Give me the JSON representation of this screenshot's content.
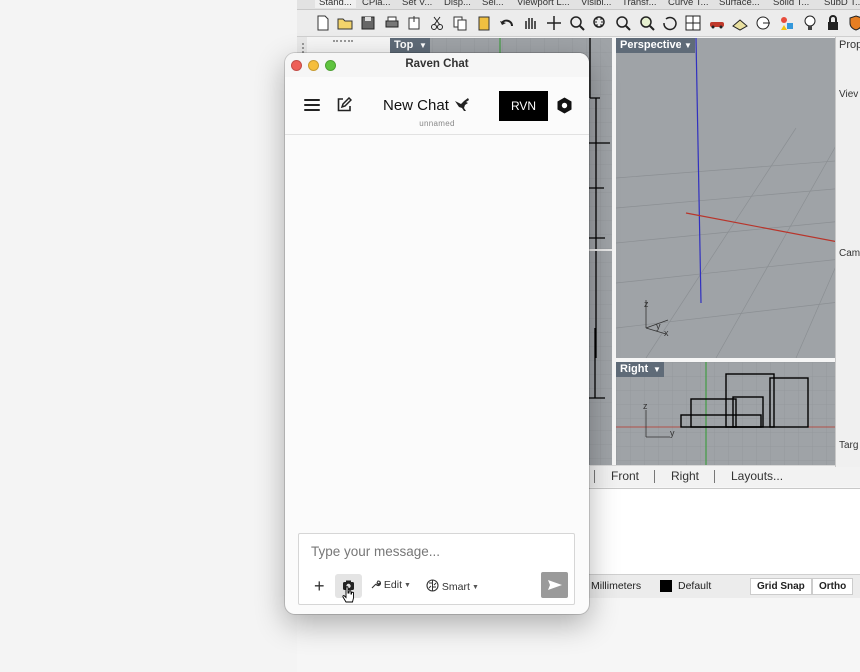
{
  "rhino": {
    "toolbar_tabs": [
      "Stand...",
      "CPla...",
      "Set V...",
      "Disp...",
      "Sel...",
      "Viewport L...",
      "Visibi...",
      "Transf...",
      "Curve T...",
      "Surface...",
      "Solid T...",
      "SubD T..."
    ],
    "viewports": {
      "top": "Top",
      "perspective": "Perspective",
      "right": "Right"
    },
    "view_tabs": [
      "Front",
      "Right",
      "Layouts..."
    ],
    "properties_panel": {
      "title": "Prop",
      "view_label": "Viev",
      "camera_label": "Cam",
      "target_label": "Targ"
    },
    "status_bar": {
      "units": "Millimeters",
      "layer": "Default",
      "grid_snap": "Grid Snap",
      "ortho": "Ortho"
    },
    "colors": {
      "viewport_bg": "#9fa3a7",
      "viewport_label_bg": "#5f6b78",
      "x_axis": "#b8352b",
      "y_axis": "#2f9b2f",
      "z_axis": "#3030c0"
    }
  },
  "chat": {
    "window_title": "Raven Chat",
    "title": "New Chat",
    "subtitle": "unnamed",
    "brand_button": "RVN",
    "input_placeholder": "Type your message...",
    "edit_mode": "Edit",
    "model_mode": "Smart",
    "icons": [
      "menu-icon",
      "compose-icon",
      "raven-icon",
      "settings-icon",
      "plus-icon",
      "camera-icon",
      "wrench-icon",
      "brain-icon",
      "send-icon"
    ]
  }
}
